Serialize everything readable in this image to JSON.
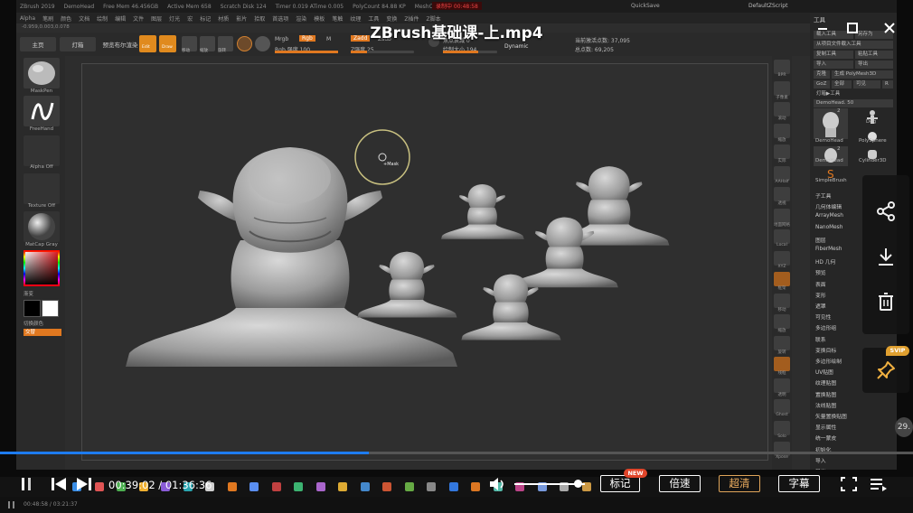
{
  "video": {
    "title": "ZBrush基础课-上.mp4",
    "current_time": "00:39:02",
    "duration": "01:36:36",
    "time_sep": " / ",
    "progress_fraction": 0.404,
    "volume_fraction": 0.9,
    "buttons": {
      "mark": "标记",
      "new_badge": "NEW",
      "speed": "倍速",
      "quality": "超清",
      "subtitle": "字幕"
    },
    "svip": "SVIP",
    "status_time": "00:48:58 / 03:21:37",
    "side_value": "29."
  },
  "zbrush": {
    "titlebar": [
      "ZBrush 2019",
      "DemoHead",
      "Free Mem 46.456GB",
      "Active Mem 658",
      "Scratch Disk 124",
      "Timer 0.019 ATime 0.005",
      "PolyCount 84.88 KP",
      "MeshCount 1"
    ],
    "rec": "录制中 00:48:58",
    "quicksave": "QuickSave",
    "default_script": "DefaultZScript",
    "menus": [
      "Alpha",
      "笔刷",
      "颜色",
      "文档",
      "绘制",
      "编辑",
      "文件",
      "图层",
      "灯光",
      "宏",
      "标记",
      "材质",
      "影片",
      "拾取",
      "首选项",
      "渲染",
      "模板",
      "笔触",
      "纹理",
      "工具",
      "变换",
      "Z插件",
      "Z脚本"
    ],
    "coords": "-0.959,0.003,0.078",
    "toolbar": {
      "home": "主页",
      "lightbox": "灯箱",
      "preview": "预览布尔渲染",
      "edit": "Edit",
      "draw": "Draw",
      "move": "移动",
      "scale": "缩放",
      "rotate": "旋转",
      "mrgb": "Mrgb",
      "rgb": "Rgb",
      "m": "M",
      "rgb_intensity": "Rgb 强度 100",
      "zadd": "Zadd",
      "zsub": "Zsub",
      "z_intensity": "Z强度 25",
      "focal": "焦点衰减 0",
      "draw_size": "绘制大小 194",
      "dynamic": "Dynamic",
      "active_points": "当前激活点数: 37,095",
      "total_points": "总点数: 69,205",
      "rgb_intensity_value": 100,
      "z_intensity_value": 25,
      "draw_size_value": 194
    },
    "left": {
      "brush": "MaskPen",
      "stroke": "FreeHand",
      "alpha": "Alpha Off",
      "texture": "Texture Off",
      "material": "MatCap Gray",
      "gradient": "渐变",
      "switch": "切换颜色",
      "swap": "交替"
    },
    "right_shelf": [
      "BPR",
      "子像素",
      "滚动",
      "缩放",
      "实际",
      "AAHalf",
      "透视",
      "地面网格",
      "Local",
      "XYZ",
      "框架",
      "移动",
      "缩放",
      "旋转",
      "线框",
      "透明",
      "Ghost",
      "Solo",
      "Xpose"
    ],
    "panel": {
      "header": "工具",
      "buttons": [
        "载入工具",
        "另存为",
        "从项目文件载入工具",
        "复制工具",
        "粘贴工具",
        "导入",
        "导出",
        "克隆",
        "生成 PolyMesh3D",
        "GoZ",
        "全部",
        "可见",
        "R",
        "灯箱▶工具"
      ],
      "tool_name": "DemoHead. 50",
      "thumbs": [
        "DemoHead",
        "Dog",
        "PolySphere",
        "DemoHead",
        "Cylinder3D",
        "SimpleBrush"
      ],
      "thumb_count": "2",
      "items": [
        "子工具",
        "几何体编辑",
        "ArrayMesh",
        "NanoMesh",
        "图层",
        "FiberMesh",
        "HD 几何",
        "预览",
        "表面",
        "变形",
        "遮罩",
        "可见性",
        "多边形组",
        "联系",
        "变换目标",
        "多边形绘制",
        "UV贴图",
        "纹理贴图",
        "置换贴图",
        "法线贴图",
        "矢量置换贴图",
        "显示属性",
        "统一蒙皮",
        "初始化",
        "导入",
        "导出"
      ]
    },
    "cursor_label": "+Mask"
  },
  "colors": {
    "accent": "#1e7cf0",
    "orange": "#e07820",
    "gold": "#e0a55a",
    "badge": "#e0452a"
  }
}
